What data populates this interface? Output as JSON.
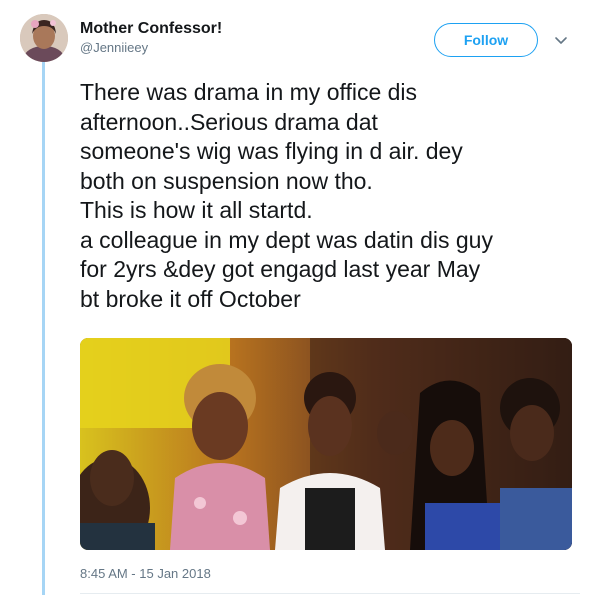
{
  "author": {
    "name": "Mother Confessor!",
    "handle": "@Jenniieey"
  },
  "follow_label": "Follow",
  "tweet_lines": [
    "There was drama in my office dis",
    "afternoon..Serious drama dat",
    "someone's wig was flying in d air. dey",
    "both on suspension now tho.",
    "This is how it all startd.",
    "a colleague in my dept was datin dis guy",
    "for 2yrs &dey got engagd last year May",
    "bt broke it off October"
  ],
  "timestamp": "8:45 AM - 15 Jan 2018",
  "colors": {
    "accent": "#1da1f2",
    "thread_line": "#a6d5f5",
    "secondary_text": "#657786"
  },
  "icons": {
    "caret": "chevron-down-icon"
  }
}
